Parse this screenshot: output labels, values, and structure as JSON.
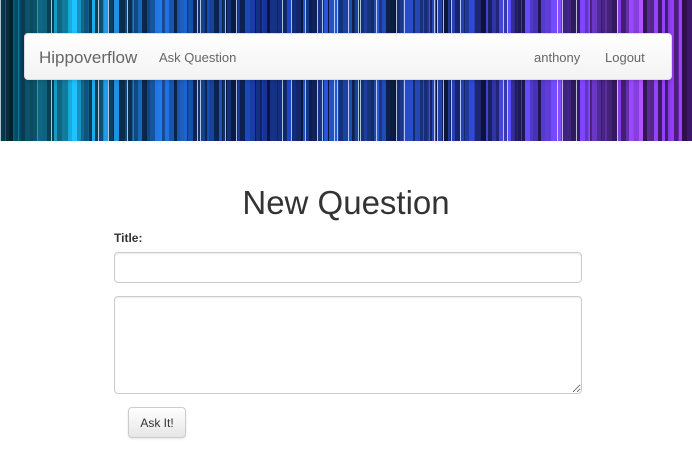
{
  "navbar": {
    "brand": "Hippoverflow",
    "ask_question": "Ask Question",
    "username": "anthony",
    "logout": "Logout"
  },
  "main": {
    "title": "New Question",
    "title_label": "Title:",
    "title_value": "",
    "body_value": "",
    "submit_label": "Ask It!"
  },
  "colors": {
    "hero_dark": "#0b2a5a",
    "hero_cyan": "#29b6d8",
    "hero_blue": "#2f6fd6",
    "hero_purple": "#7a3fd0",
    "nav_text": "#666666",
    "heading_text": "#333333"
  }
}
